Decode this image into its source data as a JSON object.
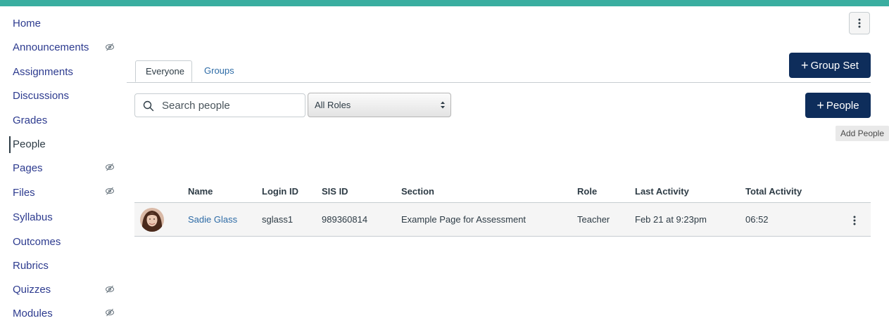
{
  "sidebar": {
    "items": [
      {
        "label": "Home",
        "hidden": false
      },
      {
        "label": "Announcements",
        "hidden": true
      },
      {
        "label": "Assignments",
        "hidden": false
      },
      {
        "label": "Discussions",
        "hidden": false
      },
      {
        "label": "Grades",
        "hidden": false
      },
      {
        "label": "People",
        "hidden": false,
        "active": true
      },
      {
        "label": "Pages",
        "hidden": true
      },
      {
        "label": "Files",
        "hidden": true
      },
      {
        "label": "Syllabus",
        "hidden": false
      },
      {
        "label": "Outcomes",
        "hidden": false
      },
      {
        "label": "Rubrics",
        "hidden": false
      },
      {
        "label": "Quizzes",
        "hidden": true
      },
      {
        "label": "Modules",
        "hidden": true
      }
    ]
  },
  "tabs": {
    "everyone": "Everyone",
    "groups": "Groups"
  },
  "toolbar": {
    "group_set_label": "Group Set",
    "people_label": "People",
    "add_people_tooltip": "Add People",
    "search_placeholder": "Search people",
    "roles_selected": "All Roles"
  },
  "table": {
    "headers": {
      "name": "Name",
      "login_id": "Login ID",
      "sis_id": "SIS ID",
      "section": "Section",
      "role": "Role",
      "last_activity": "Last Activity",
      "total_activity": "Total Activity"
    },
    "rows": [
      {
        "name": "Sadie Glass",
        "login_id": "sglass1",
        "sis_id": "989360814",
        "section": "Example Page for Assessment",
        "role": "Teacher",
        "last_activity": "Feb 21 at 9:23pm",
        "total_activity": "06:52"
      }
    ]
  },
  "colors": {
    "frame": "#3aaea0",
    "link": "#2d3b8f",
    "primary_button": "#0e2d5b"
  }
}
